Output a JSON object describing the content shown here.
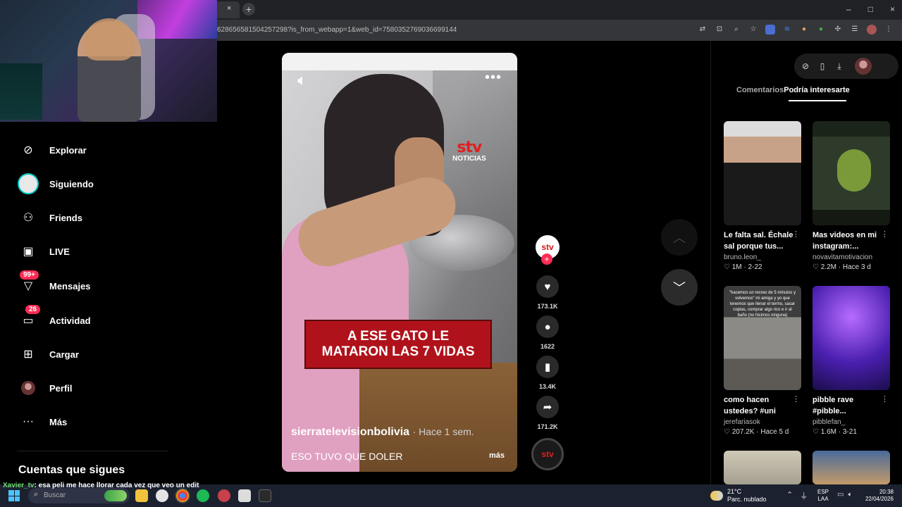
{
  "browser": {
    "tab_close": "×",
    "new_tab": "+",
    "url": "628656581504257298?is_from_webapp=1&web_id=7580352769036699144",
    "window_controls": [
      "–",
      "□",
      "×"
    ]
  },
  "sidebar": {
    "items": [
      {
        "label": "Explorar",
        "icon": "compass-icon"
      },
      {
        "label": "Siguiendo",
        "icon": "following-avatar-icon"
      },
      {
        "label": "Friends",
        "icon": "friends-icon"
      },
      {
        "label": "LIVE",
        "icon": "live-tv-icon"
      },
      {
        "label": "Mensajes",
        "icon": "messages-icon",
        "badge": "99+"
      },
      {
        "label": "Actividad",
        "icon": "activity-icon",
        "badge": "26"
      },
      {
        "label": "Cargar",
        "icon": "upload-icon"
      },
      {
        "label": "Perfil",
        "icon": "profile-avatar-icon"
      },
      {
        "label": "Más",
        "icon": "more-dots-icon"
      }
    ],
    "following_header": "Cuentas que sigues"
  },
  "video": {
    "watermark": "stv",
    "watermark_sub": "NOTICIAS",
    "caption_overlay": "A ESE GATO LE\nMATARON LAS 7 VIDAS",
    "author": "sierratelevisionbolivia",
    "time_ago": "· Hace 1 sem.",
    "description": "ESO TUVO QUE DOLER",
    "more_label": "más"
  },
  "actions": {
    "avatar_text": "stv",
    "likes": "173.1K",
    "comments": "1622",
    "saves": "13.4K",
    "shares": "171.2K",
    "disc_text": "stv"
  },
  "right_panel": {
    "tabs": [
      "Comentarios",
      "Podría interesarte"
    ],
    "cards": [
      {
        "title": "Le falta sal. Échale sal porque tus...",
        "author": "bruno.leon_",
        "likes": "1M",
        "date": "2-22"
      },
      {
        "title": "Mas videos en mi instagram:...",
        "author": "novavitamotivacion",
        "likes": "2.2M",
        "date": "Hace 3 d"
      },
      {
        "title": "como hacen ustedes? #uni",
        "author": "jerefariasok",
        "likes": "207.2K",
        "date": "Hace 5 d",
        "thumb_text": "\"hacemos un recreo de 5 minutos y volvemos\" mi amiga y yo que tenemos que llenar el termo, sacar copias, comprar algo rico e ir al baño (no hicimos ninguna)"
      },
      {
        "title": "pibble rave #pibble...",
        "author": "pibblefan_",
        "likes": "1.6M",
        "date": "3-21"
      }
    ]
  },
  "chat": {
    "user": "Xavier_tv",
    "message": ": esa peli me hace llorar cada vez que veo un edit"
  },
  "taskbar": {
    "search_placeholder": "Buscar",
    "weather_temp": "21°C",
    "weather_desc": "Parc. nublado",
    "lang_1": "ESP",
    "lang_2": "LAA",
    "time": "20:38",
    "date": "22/04/2026"
  }
}
